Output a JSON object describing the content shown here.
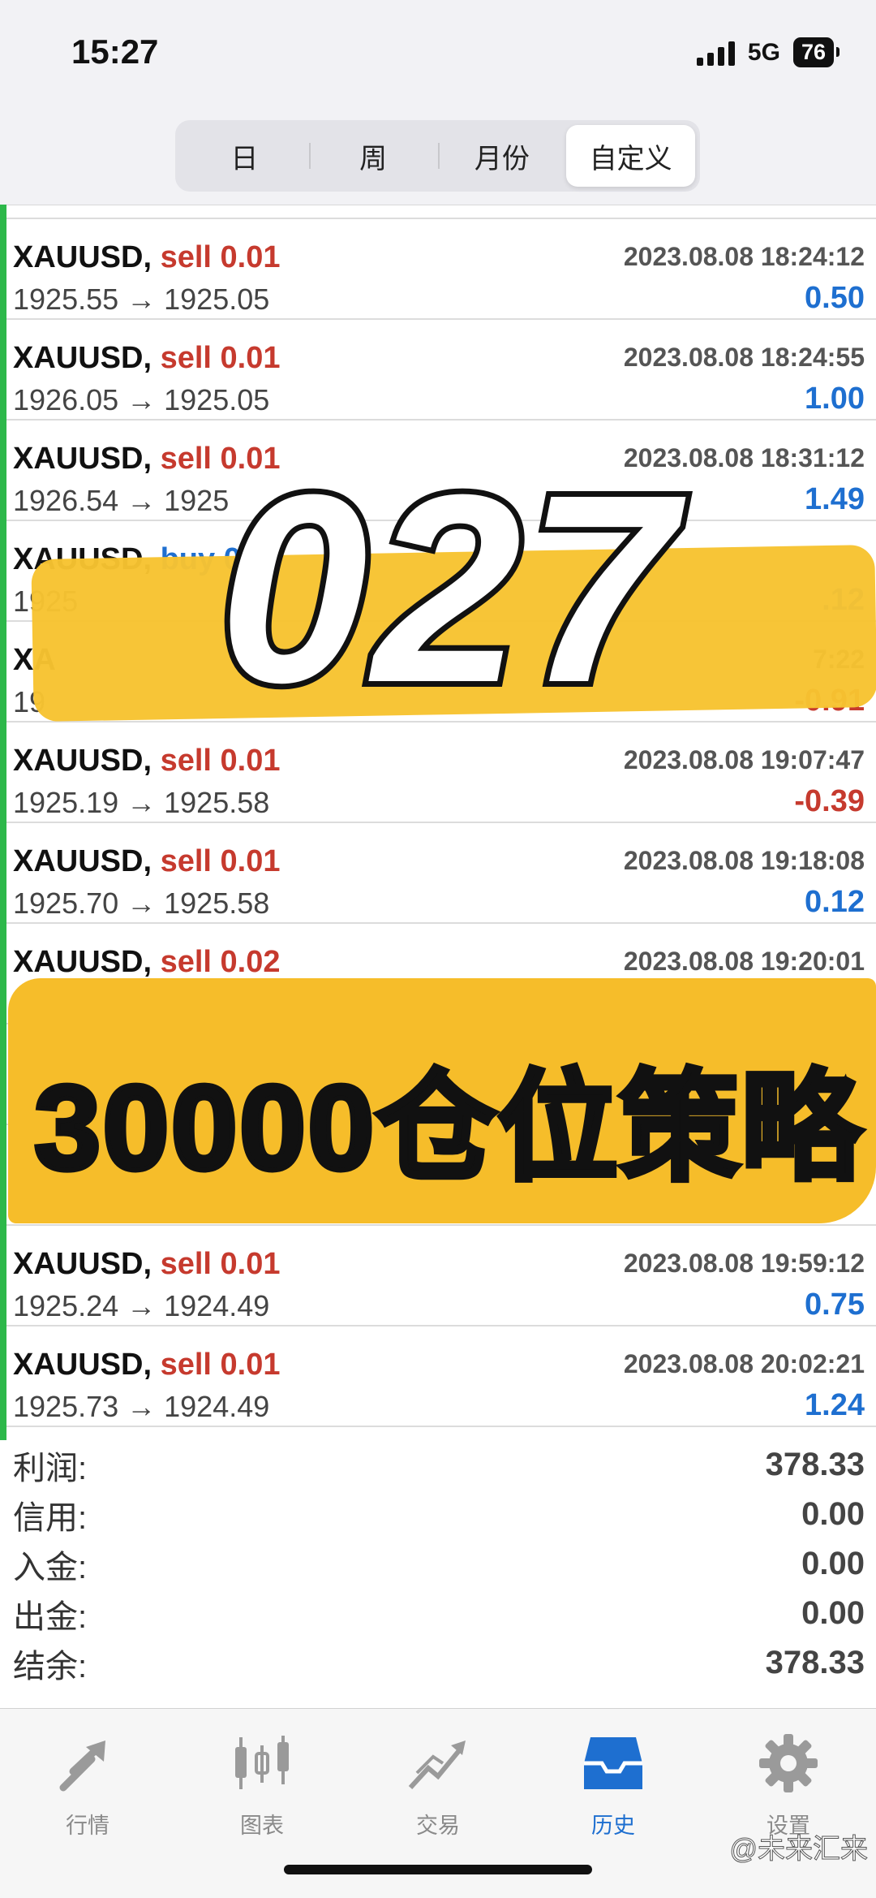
{
  "status_bar": {
    "time": "15:27",
    "network": "5G",
    "battery": "76"
  },
  "segments": [
    "日",
    "周",
    "月份",
    "自定义"
  ],
  "trades": [
    {
      "symbol": "XAUUSD,",
      "side": "sell",
      "volume": "0.01",
      "date": "2023.08.08 18:24:12",
      "prices": "1925.55 → 1925.05",
      "profit": "0.50"
    },
    {
      "symbol": "XAUUSD,",
      "side": "sell",
      "volume": "0.01",
      "date": "2023.08.08 18:24:55",
      "prices": "1926.05 → 1925.05",
      "profit": "1.00"
    },
    {
      "symbol": "XAUUSD,",
      "side": "sell",
      "volume": "0.01",
      "date": "2023.08.08 18:31:12",
      "prices": "1926.54 → 1925",
      "profit": "1.49"
    },
    {
      "symbol": "XAUUSD,",
      "side": "buy",
      "volume": "0.0",
      "date": "",
      "prices": "1925",
      "profit": ".12"
    },
    {
      "symbol": "XA",
      "side": "",
      "volume": "",
      "date": "7:22",
      "prices": "19",
      "profit": "-0.91"
    },
    {
      "symbol": "XAUUSD,",
      "side": "sell",
      "volume": "0.01",
      "date": "2023.08.08 19:07:47",
      "prices": "1925.19 → 1925.58",
      "profit": "-0.39"
    },
    {
      "symbol": "XAUUSD,",
      "side": "sell",
      "volume": "0.01",
      "date": "2023.08.08 19:18:08",
      "prices": "1925.70 → 1925.58",
      "profit": "0.12"
    },
    {
      "symbol": "XAUUSD,",
      "side": "sell",
      "volume": "0.02",
      "date": "2023.08.08 19:20:01",
      "prices": "",
      "profit": ""
    },
    {
      "symbol": "",
      "side": "",
      "volume": "",
      "date": "",
      "prices": "",
      "profit": ""
    },
    {
      "symbol": "",
      "side": "",
      "volume": "",
      "date": "",
      "prices": "",
      "profit": ""
    },
    {
      "symbol": "XAUUSD,",
      "side": "sell",
      "volume": "0.01",
      "date": "2023.08.08 19:59:12",
      "prices": "1925.24 → 1924.49",
      "profit": "0.75"
    },
    {
      "symbol": "XAUUSD,",
      "side": "sell",
      "volume": "0.01",
      "date": "2023.08.08 20:02:21",
      "prices": "1925.73 → 1924.49",
      "profit": "1.24"
    }
  ],
  "summary": [
    {
      "label": "利润:",
      "value": "378.33"
    },
    {
      "label": "信用:",
      "value": "0.00"
    },
    {
      "label": "入金:",
      "value": "0.00"
    },
    {
      "label": "出金:",
      "value": "0.00"
    },
    {
      "label": "结余:",
      "value": "378.33"
    }
  ],
  "overlay": {
    "number": "027",
    "headline": "30000仓位策略"
  },
  "tabs": [
    {
      "label": "行情",
      "icon": "quotes-icon"
    },
    {
      "label": "图表",
      "icon": "chart-candles-icon"
    },
    {
      "label": "交易",
      "icon": "trade-icon"
    },
    {
      "label": "历史",
      "icon": "history-icon"
    },
    {
      "label": "设置",
      "icon": "settings-gear-icon"
    }
  ],
  "watermark": "@未来汇来",
  "colors": {
    "sell": "#c63a2e",
    "buy": "#1e6fd0",
    "profit_positive": "#1e6fd0",
    "profit_negative": "#c63a2e",
    "accent_bar": "#2db84a",
    "overlay_yellow": "#f7c331"
  }
}
